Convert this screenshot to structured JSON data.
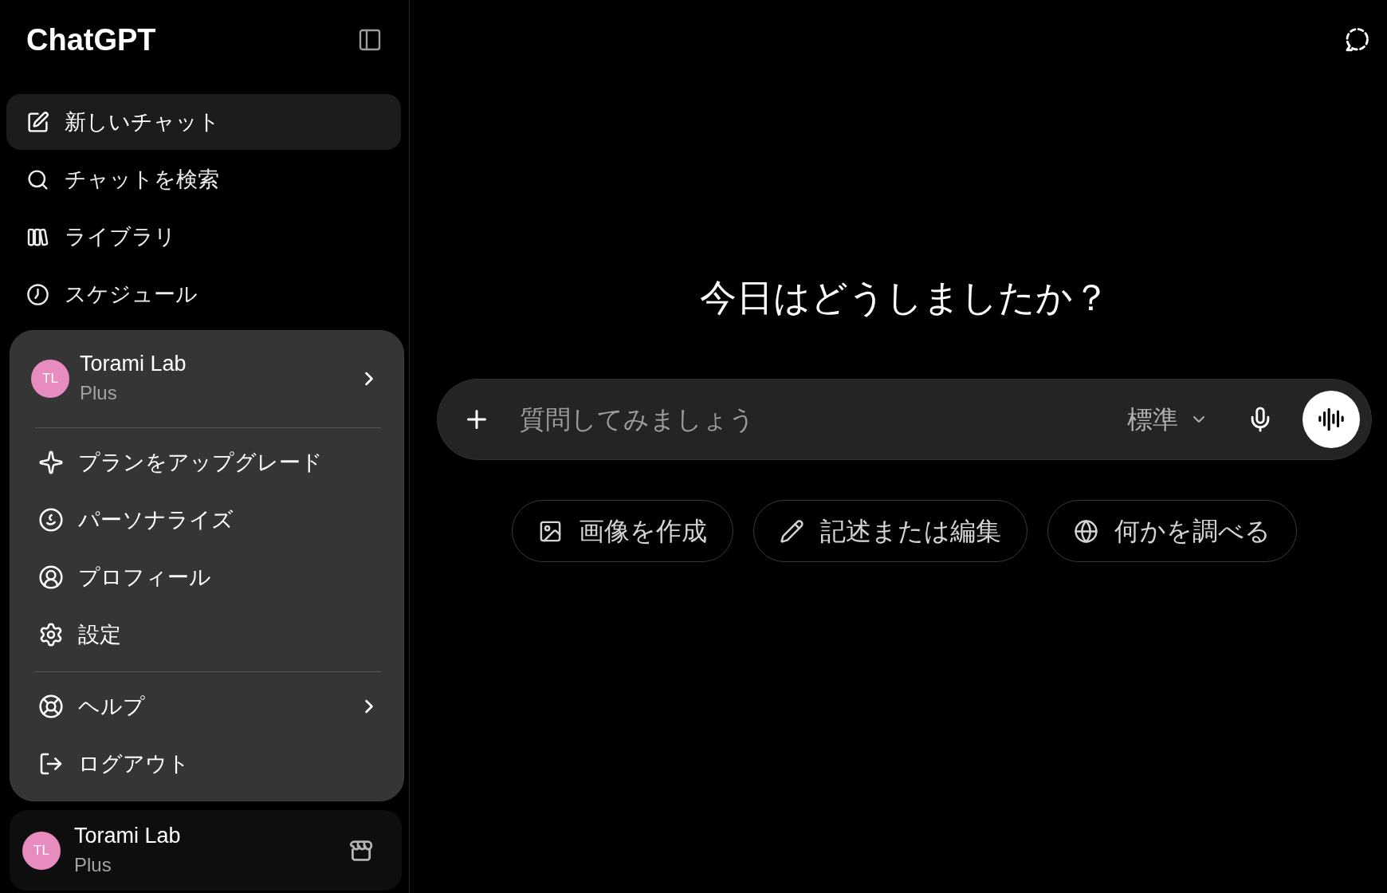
{
  "sidebar": {
    "logo": "ChatGPT",
    "nav": [
      {
        "label": "新しいチャット",
        "selected": true
      },
      {
        "label": "チャットを検索",
        "selected": false
      },
      {
        "label": "ライブラリ",
        "selected": false
      },
      {
        "label": "スケジュール",
        "selected": false
      }
    ],
    "account_menu": {
      "account": {
        "initials": "TL",
        "name": "Torami Lab",
        "plan": "Plus"
      },
      "sections": [
        {
          "items": [
            {
              "label": "プランをアップグレード",
              "submenu": false
            },
            {
              "label": "パーソナライズ",
              "submenu": false
            },
            {
              "label": "プロフィール",
              "submenu": false
            },
            {
              "label": "設定",
              "submenu": false
            }
          ]
        },
        {
          "items": [
            {
              "label": "ヘルプ",
              "submenu": true
            },
            {
              "label": "ログアウト",
              "submenu": false
            }
          ]
        }
      ]
    },
    "account": {
      "initials": "TL",
      "name": "Torami Lab",
      "plan": "Plus"
    }
  },
  "main": {
    "heading": "今日はどうしましたか？",
    "composer": {
      "placeholder": "質問してみましょう",
      "model": "標準"
    },
    "suggestions": [
      "画像を作成",
      "記述または編集",
      "何かを調べる"
    ]
  }
}
